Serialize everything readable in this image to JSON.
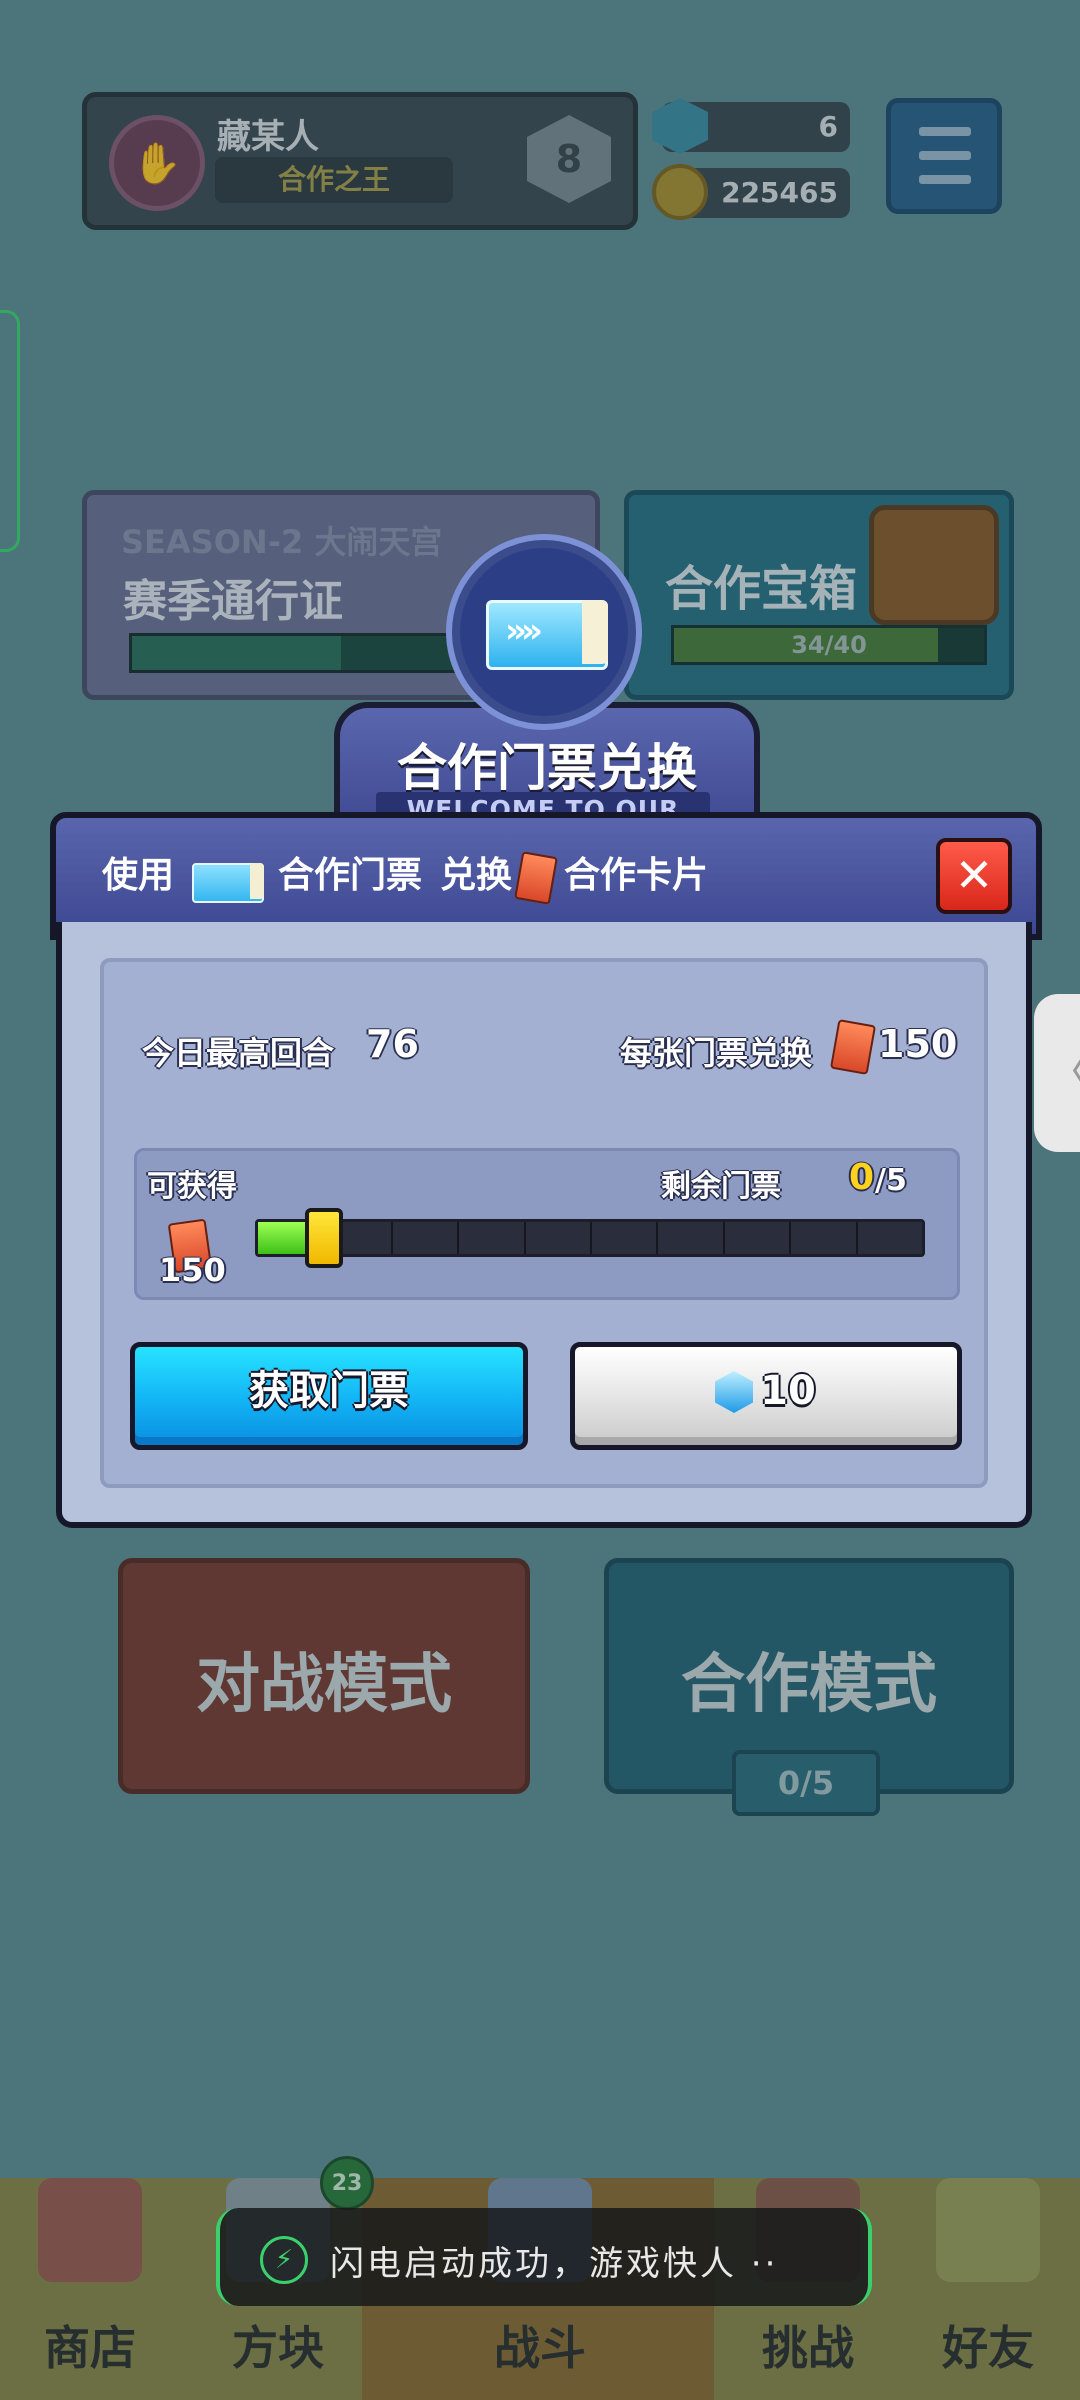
{
  "player": {
    "name": "藏某人",
    "title": "合作之王",
    "rank": "8"
  },
  "currency": {
    "gems": "6",
    "coins": "225465"
  },
  "season_pass": {
    "subtitle": "SEASON-2 大闹天宫",
    "title": "赛季通行证",
    "progress": 0.55
  },
  "coop_chest": {
    "title": "合作宝箱",
    "progress_text": "34/40",
    "progress": 0.85
  },
  "modes": {
    "battle": "对战模式",
    "coop": "合作模式",
    "coop_count": "0/5"
  },
  "dialog": {
    "title": "合作门票兑换",
    "subtitle": "WELCOME TO OUR SHOP",
    "header": {
      "use": "使用",
      "ticket_label": "合作门票",
      "exchange": "兑换",
      "card_label": "合作卡片"
    },
    "today_max_label": "今日最高回合",
    "today_max_value": "76",
    "per_ticket_label": "每张门票兑换",
    "per_ticket_value": "150",
    "obtainable_label": "可获得",
    "obtainable_value": "150",
    "remaining_label": "剩余门票",
    "remaining_current": "0",
    "remaining_total": "/5",
    "slider_fraction": 0.1,
    "get_ticket_button": "获取门票",
    "gem_cost": "10"
  },
  "toast": {
    "text": "闪电启动成功，游戏快人 ··"
  },
  "nav": {
    "shop": "商店",
    "blocks": "方块",
    "battle": "战斗",
    "challenge": "挑战",
    "friends": "好友",
    "blocks_badge": "23"
  },
  "colors": {
    "accent_cyan": "#12b3f5",
    "close_red": "#d9261b",
    "slider_green": "#3dc018",
    "slider_yellow": "#f0b800",
    "dialog_blue": "#3d4892"
  }
}
